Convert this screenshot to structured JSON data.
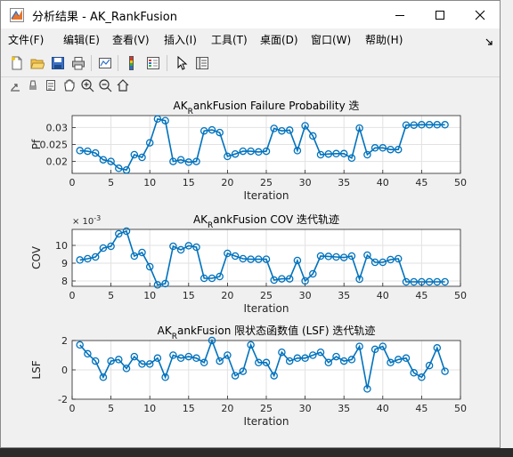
{
  "window": {
    "title": "分析结果 - AK_RankFusion"
  },
  "menu": [
    "文件(F)",
    "编辑(E)",
    "查看(V)",
    "插入(I)",
    "工具(T)",
    "桌面(D)",
    "窗口(W)",
    "帮助(H)"
  ],
  "toolbar": [
    "new-icon",
    "open-icon",
    "save-icon",
    "print-icon",
    "link-plot-icon",
    "colorbar-icon",
    "legend-icon",
    "pointer-icon",
    "property-inspector-icon"
  ],
  "axes_toolbar": [
    "export-icon",
    "brush-icon",
    "datatip-icon",
    "pan-icon",
    "zoom-in-icon",
    "zoom-out-icon",
    "home-icon"
  ],
  "colors": {
    "line": "#0072bd",
    "grid": "#e2e2e2",
    "axes_bg": "#ffffff",
    "figure_bg": "#f0f0f0"
  },
  "chart_data": [
    {
      "type": "line",
      "title": {
        "pre": "AK",
        "sub": "R",
        "post": "ankFusion Failure Probability 迭"
      },
      "xlabel": "Iteration",
      "ylabel": "Pf",
      "xlim": [
        0,
        50
      ],
      "ylim": [
        0.0165,
        0.0335
      ],
      "xticks": [
        "0",
        "5",
        "10",
        "15",
        "20",
        "25",
        "30",
        "35",
        "40",
        "45",
        "50"
      ],
      "yticks": [
        "0.02",
        "0.025",
        "0.03"
      ],
      "x": [
        1,
        2,
        3,
        4,
        5,
        6,
        7,
        8,
        9,
        10,
        11,
        12,
        13,
        14,
        15,
        16,
        17,
        18,
        19,
        20,
        21,
        22,
        23,
        24,
        25,
        26,
        27,
        28,
        29,
        30,
        31,
        32,
        33,
        34,
        35,
        36,
        37,
        38,
        39,
        40,
        41,
        42,
        43,
        44,
        45,
        46,
        47,
        48
      ],
      "values": [
        0.0232,
        0.023,
        0.0225,
        0.0205,
        0.02,
        0.018,
        0.0175,
        0.022,
        0.0212,
        0.0255,
        0.0325,
        0.032,
        0.02,
        0.0205,
        0.0198,
        0.02,
        0.029,
        0.0293,
        0.0285,
        0.0215,
        0.0222,
        0.023,
        0.023,
        0.0228,
        0.023,
        0.0297,
        0.029,
        0.0292,
        0.0232,
        0.0305,
        0.0275,
        0.022,
        0.0222,
        0.0223,
        0.0223,
        0.021,
        0.0298,
        0.022,
        0.024,
        0.024,
        0.0235,
        0.0235,
        0.0307,
        0.0307,
        0.0308,
        0.0308,
        0.0308,
        0.0308
      ],
      "grid": true
    },
    {
      "type": "line",
      "title": {
        "pre": "AK",
        "sub": "R",
        "post": "ankFusion COV 迭代轨迹"
      },
      "xlabel": "Iteration",
      "ylabel": "COV",
      "exponent": "× 10",
      "exponent_power": "-3",
      "xlim": [
        0,
        50
      ],
      "ylim": [
        0.0077,
        0.0109
      ],
      "xticks": [
        "0",
        "5",
        "10",
        "15",
        "20",
        "25",
        "30",
        "35",
        "40",
        "45",
        "50"
      ],
      "yticks": [
        "8",
        "9",
        "10"
      ],
      "x": [
        1,
        2,
        3,
        4,
        5,
        6,
        7,
        8,
        9,
        10,
        11,
        12,
        13,
        14,
        15,
        16,
        17,
        18,
        19,
        20,
        21,
        22,
        23,
        24,
        25,
        26,
        27,
        28,
        29,
        30,
        31,
        32,
        33,
        34,
        35,
        36,
        37,
        38,
        39,
        40,
        41,
        42,
        43,
        44,
        45,
        46,
        47,
        48
      ],
      "values": [
        0.00918,
        0.00925,
        0.00935,
        0.00985,
        0.00995,
        0.01065,
        0.0108,
        0.0094,
        0.0096,
        0.0088,
        0.00778,
        0.00785,
        0.00995,
        0.00975,
        0.00998,
        0.0099,
        0.00815,
        0.00815,
        0.00825,
        0.00955,
        0.0094,
        0.00925,
        0.00922,
        0.00922,
        0.00922,
        0.00805,
        0.00812,
        0.00812,
        0.00915,
        0.008,
        0.0084,
        0.0094,
        0.00938,
        0.00935,
        0.00932,
        0.0094,
        0.0081,
        0.00945,
        0.00905,
        0.00905,
        0.0092,
        0.00925,
        0.00795,
        0.00795,
        0.00795,
        0.00795,
        0.00795,
        0.00795
      ],
      "grid": true
    },
    {
      "type": "line",
      "title": {
        "pre": "AK",
        "sub": "R",
        "post": "ankFusion 限状态函数值 (LSF) 迭代轨迹"
      },
      "xlabel": "Iteration",
      "ylabel": "LSF",
      "xlim": [
        0,
        50
      ],
      "ylim": [
        -2,
        2
      ],
      "xticks": [
        "0",
        "5",
        "10",
        "15",
        "20",
        "25",
        "30",
        "35",
        "40",
        "45",
        "50"
      ],
      "yticks": [
        "-2",
        "0",
        "2"
      ],
      "x": [
        1,
        2,
        3,
        4,
        5,
        6,
        7,
        8,
        9,
        10,
        11,
        12,
        13,
        14,
        15,
        16,
        17,
        18,
        19,
        20,
        21,
        22,
        23,
        24,
        25,
        26,
        27,
        28,
        29,
        30,
        31,
        32,
        33,
        34,
        35,
        36,
        37,
        38,
        39,
        40,
        41,
        42,
        43,
        44,
        45,
        46,
        47,
        48
      ],
      "values": [
        1.7,
        1.1,
        0.6,
        -0.5,
        0.6,
        0.7,
        0.1,
        0.9,
        0.4,
        0.4,
        0.8,
        -0.5,
        1.0,
        0.8,
        0.9,
        0.8,
        0.5,
        2.0,
        0.6,
        1.0,
        -0.4,
        -0.1,
        1.7,
        0.5,
        0.5,
        -0.4,
        1.2,
        0.6,
        0.8,
        0.8,
        1.0,
        1.2,
        0.5,
        0.9,
        0.6,
        0.7,
        1.6,
        -1.3,
        1.4,
        1.6,
        0.5,
        0.7,
        0.8,
        -0.2,
        -0.5,
        0.3,
        1.5,
        -0.1
      ],
      "grid": true
    }
  ]
}
